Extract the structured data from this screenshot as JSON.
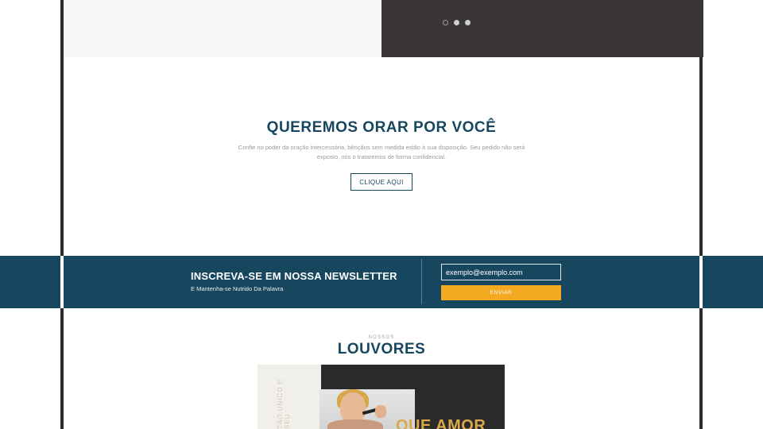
{
  "slider": {
    "dots": [
      {
        "name": "slide-1",
        "active": true
      },
      {
        "name": "slide-2",
        "active": false
      },
      {
        "name": "slide-3",
        "active": false
      }
    ]
  },
  "prayer": {
    "title": "QUEREMOS ORAR POR VOCÊ",
    "text": "Confie no poder da oração intercessória, bênçãos sem medida estão à sua disposição. Seu pedido não será exposto, nós o trataremos de forma confidencial.",
    "button_label": "CLIQUE AQUI"
  },
  "newsletter": {
    "title": "INSCREVA-SE EM NOSSA NEWSLETTER",
    "subtitle": "E Mantenha-se Nutrido Da Palavra",
    "email_value": "exemplo@exemplo.com",
    "submit_label": "ENVIAR"
  },
  "louvores": {
    "eyebrow": "NOSSOS",
    "title": "LOUVORES",
    "album_word": "QUE AMOR",
    "album_side_text": "TÃO ÚNICO E SEU"
  },
  "colors": {
    "primary": "#17475f",
    "accent": "#f3a920",
    "dark": "#3a3636"
  }
}
